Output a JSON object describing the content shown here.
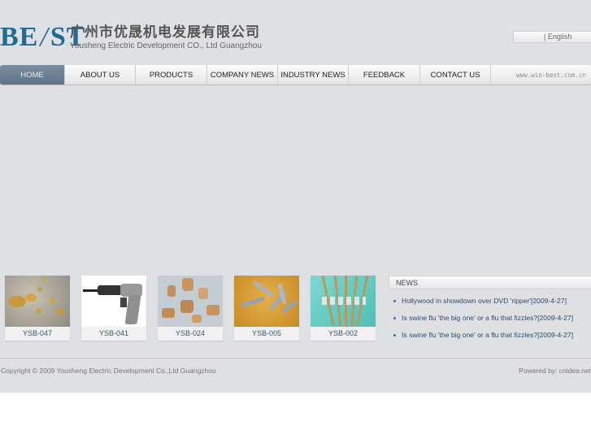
{
  "header": {
    "logo_mark": [
      "BE",
      "/",
      "ST"
    ],
    "company_name_cn": "广州市优晟机电发展有限公司",
    "company_name_en": "Yousheng Electric Development CO., Ltd Guangzhou",
    "language_link": "| English"
  },
  "nav": {
    "items": [
      {
        "label": "HOME",
        "active": true
      },
      {
        "label": "ABOUT US",
        "active": false
      },
      {
        "label": "PRODUCTS",
        "active": false
      },
      {
        "label": "COMPANY NEWS",
        "active": false
      },
      {
        "label": "INDUSTRY NEWS",
        "active": false
      },
      {
        "label": "FEEDBACK",
        "active": false
      },
      {
        "label": "CONTACT US",
        "active": false
      }
    ],
    "site_url": "www.win-best.com.cn",
    "active_color": "#6a7e94"
  },
  "products": [
    {
      "code": "YSB-047",
      "image": "brass-inserts"
    },
    {
      "code": "YSB-041",
      "image": "rivet-gun"
    },
    {
      "code": "YSB-024",
      "image": "rivet-nuts"
    },
    {
      "code": "YSB-005",
      "image": "anchor-bolts"
    },
    {
      "code": "YSB-002",
      "image": "blind-rivets"
    }
  ],
  "news": {
    "title": "NEWS",
    "items": [
      {
        "text": "Hollywood in showdown over DVD 'ripper'",
        "date": "[2009-4-27]"
      },
      {
        "text": "Is swine flu 'the big one' or a flu that fizzles?",
        "date": "[2009-4-27]"
      },
      {
        "text": "Is swine flu 'the big one' or a flu that fizzles?",
        "date": "[2009-4-27]"
      }
    ]
  },
  "footer": {
    "copyright": "Copyright © 2009 Yousheng Electric Development Co.,Ltd Guangzhou",
    "powered_by": "Powered by: cnidea.net"
  }
}
